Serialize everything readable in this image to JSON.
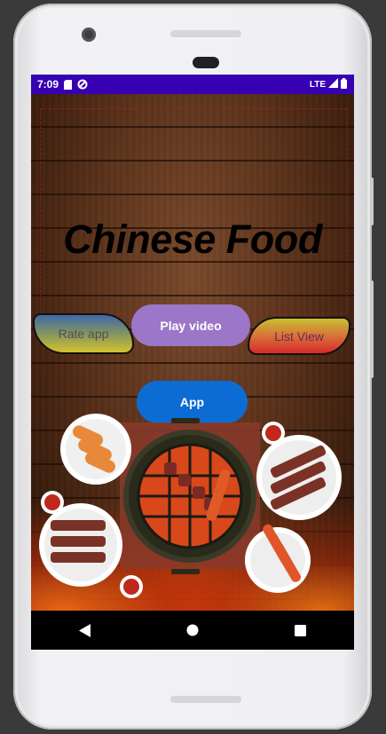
{
  "status_bar": {
    "time": "7:09",
    "network": "LTE",
    "icons": [
      "sd-card-icon",
      "sync-icon",
      "signal-icon",
      "battery-icon"
    ]
  },
  "app": {
    "title": "Chinese Food",
    "buttons": {
      "rate": "Rate app",
      "play": "Play video",
      "list": "List View",
      "app": "App"
    }
  },
  "nav_bar": {
    "icons": [
      "back-icon",
      "home-icon",
      "recents-icon"
    ]
  },
  "colors": {
    "status_bar": "#3700b3",
    "play_button": "#9c76c9",
    "app_button": "#0c6cd4"
  }
}
